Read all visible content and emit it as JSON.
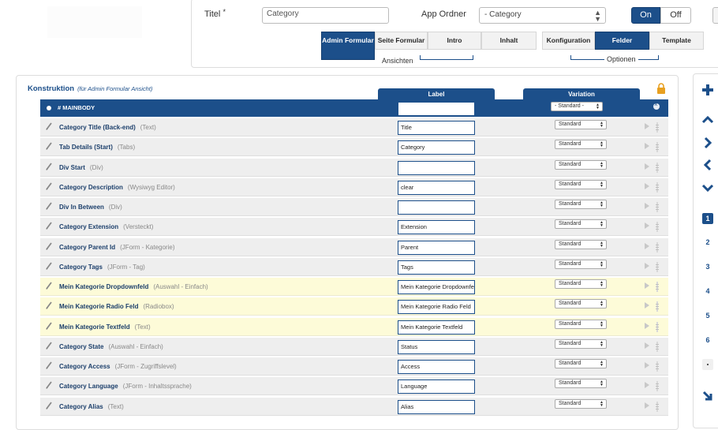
{
  "header": {
    "titel_label": "Titel",
    "titel_required_mark": "*",
    "titel_value": "Category",
    "app_ordner_label": "App Ordner",
    "app_ordner_value": "- Category",
    "toggle_on": "On",
    "toggle_off": "Off"
  },
  "ansichten": {
    "group_label": "Ansichten",
    "tabs": [
      {
        "label": "Admin Formular",
        "active": true
      },
      {
        "label": "Seite Formular",
        "active": false
      },
      {
        "label": "Intro",
        "active": false
      },
      {
        "label": "Inhalt",
        "active": false
      }
    ]
  },
  "optionen": {
    "group_label": "Optionen",
    "tabs": [
      {
        "label": "Konfiguration",
        "active": false
      },
      {
        "label": "Felder",
        "active": true
      },
      {
        "label": "Template",
        "active": false
      }
    ]
  },
  "konstruktion": {
    "title": "Konstruktion",
    "subtitle": "(für Admin Formular Ansicht)",
    "col_label": "Label",
    "col_variation": "Variation",
    "mainbody": {
      "label": "# MAINBODY",
      "label_value": "",
      "variation": "- Standard -"
    },
    "rows": [
      {
        "name": "Category Title (Back-end)",
        "type": "(Text)",
        "label": "Title",
        "variation": "Standard",
        "highlight": false
      },
      {
        "name": "Tab Details (Start)",
        "type": "(Tabs)",
        "label": "Category",
        "variation": "Standard",
        "highlight": false
      },
      {
        "name": "Div Start",
        "type": "(Div)",
        "label": "",
        "variation": "Standard",
        "highlight": false
      },
      {
        "name": "Category Description",
        "type": "(Wysiwyg Editor)",
        "label": "clear",
        "variation": "Standard",
        "highlight": false
      },
      {
        "name": "Div In Between",
        "type": "(Div)",
        "label": "",
        "variation": "Standard",
        "highlight": false
      },
      {
        "name": "Category Extension",
        "type": "(Versteckt)",
        "label": "Extension",
        "variation": "Standard",
        "highlight": false
      },
      {
        "name": "Category Parent Id",
        "type": "(JForm - Kategorie)",
        "label": "Parent",
        "variation": "Standard",
        "highlight": false
      },
      {
        "name": "Category Tags",
        "type": "(JForm - Tag)",
        "label": "Tags",
        "variation": "Standard",
        "highlight": false
      },
      {
        "name": "Mein Kategorie Dropdownfeld",
        "type": "(Auswahl - Einfach)",
        "label": "Mein Kategorie Dropdownfeld",
        "variation": "Standard",
        "highlight": true
      },
      {
        "name": "Mein Kategorie Radio Feld",
        "type": "(Radiobox)",
        "label": "Mein Kategorie Radio Feld",
        "variation": "Standard",
        "highlight": true
      },
      {
        "name": "Mein Kategorie Textfeld",
        "type": "(Text)",
        "label": "Mein Kategorie Textfeld",
        "variation": "Standard",
        "highlight": true
      },
      {
        "name": "Category State",
        "type": "(Auswahl - Einfach)",
        "label": "Status",
        "variation": "Standard",
        "highlight": false
      },
      {
        "name": "Category Access",
        "type": "(JForm - Zugriffslevel)",
        "label": "Access",
        "variation": "Standard",
        "highlight": false
      },
      {
        "name": "Category Language",
        "type": "(JForm - Inhaltssprache)",
        "label": "Language",
        "variation": "Standard",
        "highlight": false
      },
      {
        "name": "Category Alias",
        "type": "(Text)",
        "label": "Alias",
        "variation": "Standard",
        "highlight": false
      }
    ]
  },
  "sidebar": {
    "icons": [
      "plus-icon",
      "chevron-up-icon",
      "chevron-right-icon",
      "chevron-left-icon",
      "chevron-down-icon",
      "collapse-icon"
    ],
    "positions": [
      "1",
      "2",
      "3",
      "4",
      "5",
      "6"
    ],
    "active_position": "1"
  },
  "colors": {
    "primary": "#1c4f8a",
    "row_bg": "#eeeeee",
    "highlight_bg": "#fdfbd8",
    "lock": "#e8a020"
  }
}
